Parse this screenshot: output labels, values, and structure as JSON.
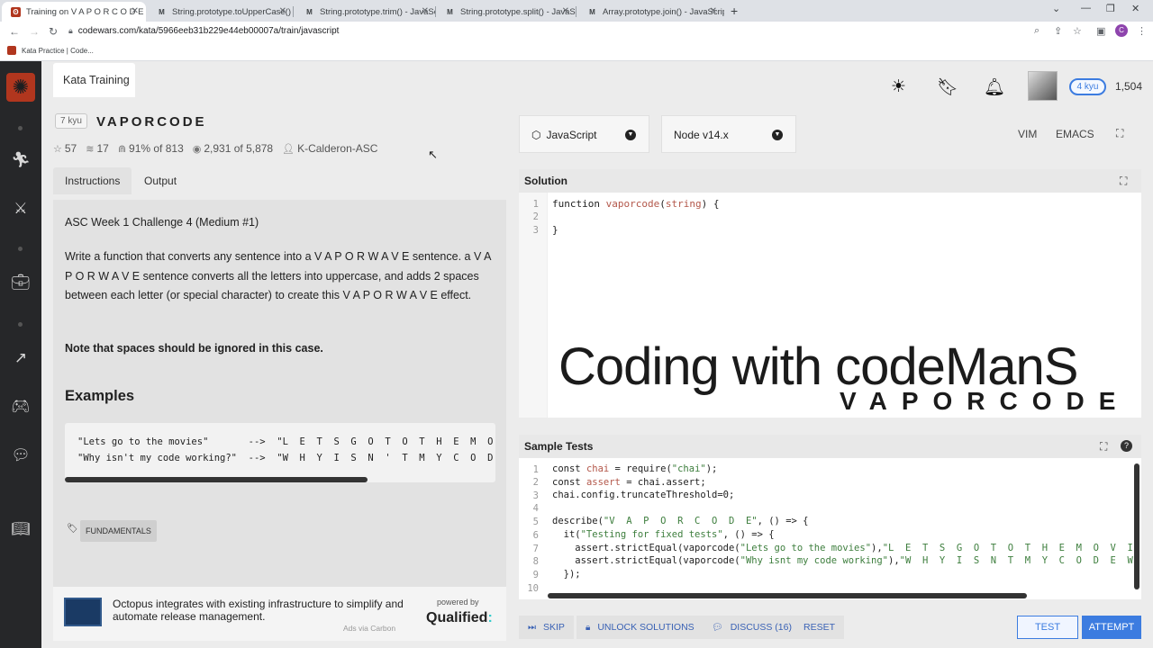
{
  "browser": {
    "tabs": [
      {
        "title": "Training on V A P O R C O D E | C",
        "favicon": "codewars"
      },
      {
        "title": "String.prototype.toUpperCase() -",
        "favicon": "M"
      },
      {
        "title": "String.prototype.trim() - JavaScri",
        "favicon": "M"
      },
      {
        "title": "String.prototype.split() - JavaScri",
        "favicon": "M"
      },
      {
        "title": "Array.prototype.join() - JavaScrip",
        "favicon": "M"
      }
    ],
    "url": "codewars.com/kata/5966eeb31b229e44eb00007a/train/javascript",
    "bookmark": "Kata Practice | Code...",
    "profile_initial": "C"
  },
  "header": {
    "kata_tab": "Kata Training",
    "honor": "1,504",
    "rank": "4 kyu"
  },
  "kata": {
    "kyu": "7 kyu",
    "name": "VAPORCODE",
    "stars": "57",
    "collections": "17",
    "satisfaction": "91% of 813",
    "completed": "2,931 of 5,878",
    "author": "K-Calderon-ASC"
  },
  "instructions": {
    "tabs": [
      "Instructions",
      "Output"
    ],
    "subtitle": "ASC Week 1 Challenge 4 (Medium #1)",
    "body": "Write a function that converts any sentence into a V A P O R W A V E sentence. a V A P O R W A V E sentence converts all the letters into uppercase, and adds 2 spaces between each letter (or special character) to create this V A P O R W A V E effect.",
    "note": "Note that spaces should be ignored in this case.",
    "examples_heading": "Examples",
    "examples": [
      "\"Lets go to the movies\"       -->  \"L  E  T  S  G  O  T  O  T  H  E  M  O  V  I  E  S\"",
      "\"Why isn't my code working?\"  -->  \"W  H  Y  I  S  N  '  T  M  Y  C  O  D  E  W  O  R  K  I  N  G  ?\""
    ],
    "tag": "FUNDAMENTALS"
  },
  "ad": {
    "text": "Octopus integrates with existing infrastructure to simplify and automate release management.",
    "via": "Ads via Carbon",
    "powered_by": "powered by",
    "brand": "Qualified",
    "brand_suffix": ":"
  },
  "editor": {
    "language": "JavaScript",
    "runtime": "Node v14.x",
    "modes": [
      "VIM",
      "EMACS"
    ],
    "solution_title": "Solution",
    "solution_lines": [
      "1",
      "2",
      "3"
    ],
    "watermark_line1": "Coding with codeManS",
    "watermark_line2": "VAPORCODE",
    "tests_title": "Sample Tests",
    "tests_lines": [
      "1",
      "2",
      "3",
      "4",
      "5",
      "6",
      "7",
      "8",
      "9",
      "10"
    ]
  },
  "actions": {
    "skip": "SKIP",
    "unlock": "UNLOCK SOLUTIONS",
    "discuss": "DISCUSS (16)",
    "reset": "RESET",
    "test": "TEST",
    "attempt": "ATTEMPT"
  },
  "colors": {
    "accent": "#3c7ce0",
    "brand": "#b1361e",
    "rail": "#262729"
  }
}
